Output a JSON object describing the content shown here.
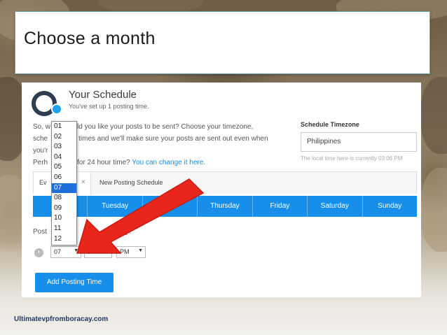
{
  "slide": {
    "title": "Choose a month",
    "footer": "Ultimatevpfromboracay.com"
  },
  "schedule": {
    "title": "Your Schedule",
    "subtitle": "You've set up 1 posting time.",
    "intro_line1": "So, w",
    "intro_line1b": "ld you like your posts to be sent? Choose your timezone,",
    "intro_line2a": "sche",
    "intro_line2b": "times and we'll make sure your posts are sent out even when",
    "intro_line3a": "you'r",
    "intro_line4a": "Perh",
    "intro_line4b": "for 24 hour time?",
    "intro_link": "You can change it here."
  },
  "timezone": {
    "label": "Schedule Timezone",
    "value": "Philippines",
    "note": "The local time here is currently 03:06 PM"
  },
  "tabs": {
    "active_label": "Ev",
    "close_glyph": "×",
    "second_label": "New Posting Schedule"
  },
  "days": [
    "",
    "Tuesday",
    "day",
    "Thursday",
    "Friday",
    "Saturday",
    "Sunday"
  ],
  "post": {
    "label": "Post",
    "label_tail": "y:",
    "hour_value": "07",
    "minute_value": "0",
    "ampm_value": "PM",
    "dropdown_arrow": "▼"
  },
  "month_options": [
    "01",
    "02",
    "03",
    "04",
    "05",
    "06",
    "07",
    "08",
    "09",
    "10",
    "11",
    "12"
  ],
  "selected_month": "07",
  "add_button": "Add Posting Time",
  "colors": {
    "accent": "#168eea",
    "arrow": "#e8261c",
    "selected_option": "#1e6fd9"
  }
}
